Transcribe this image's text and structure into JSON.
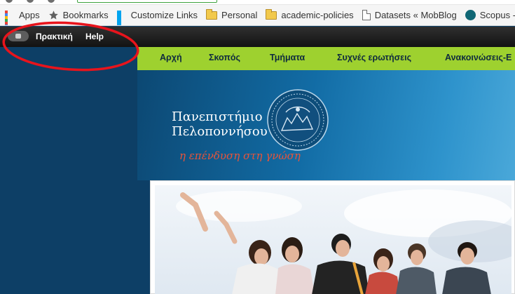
{
  "browser": {
    "bookmarks": [
      {
        "label": "Apps",
        "icon": "apps-grid-icon"
      },
      {
        "label": "Bookmarks",
        "icon": "star-icon"
      },
      {
        "label": "Customize Links",
        "icon": "windows-icon"
      },
      {
        "label": "Personal",
        "icon": "folder-icon"
      },
      {
        "label": "academic-policies",
        "icon": "folder-icon"
      },
      {
        "label": "Datasets « MobBlog",
        "icon": "page-icon"
      },
      {
        "label": "Scopus - Sources",
        "icon": "scopus-icon"
      }
    ]
  },
  "admin_bar": {
    "items": [
      "Πρακτική",
      "Help"
    ]
  },
  "site_nav": {
    "items": [
      "Αρχή",
      "Σκοπός",
      "Τμήματα",
      "Συχνές ερωτήσεις",
      "Ανακοινώσεις-Ε"
    ]
  },
  "header": {
    "university_line1": "Πανεπιστήμιο",
    "university_line2": "Πελοποννήσου",
    "motto": "η επένδυση στη γνώση"
  },
  "hero": {
    "description": "group-of-students-pointing-at-sky"
  },
  "annotation": {
    "shape": "ellipse",
    "color": "#e8141c"
  },
  "colors": {
    "nav_green": "#9ed12f",
    "banner_blue": "#126ca5",
    "page_bg": "#0d3f66",
    "motto_red": "#e8543a"
  }
}
